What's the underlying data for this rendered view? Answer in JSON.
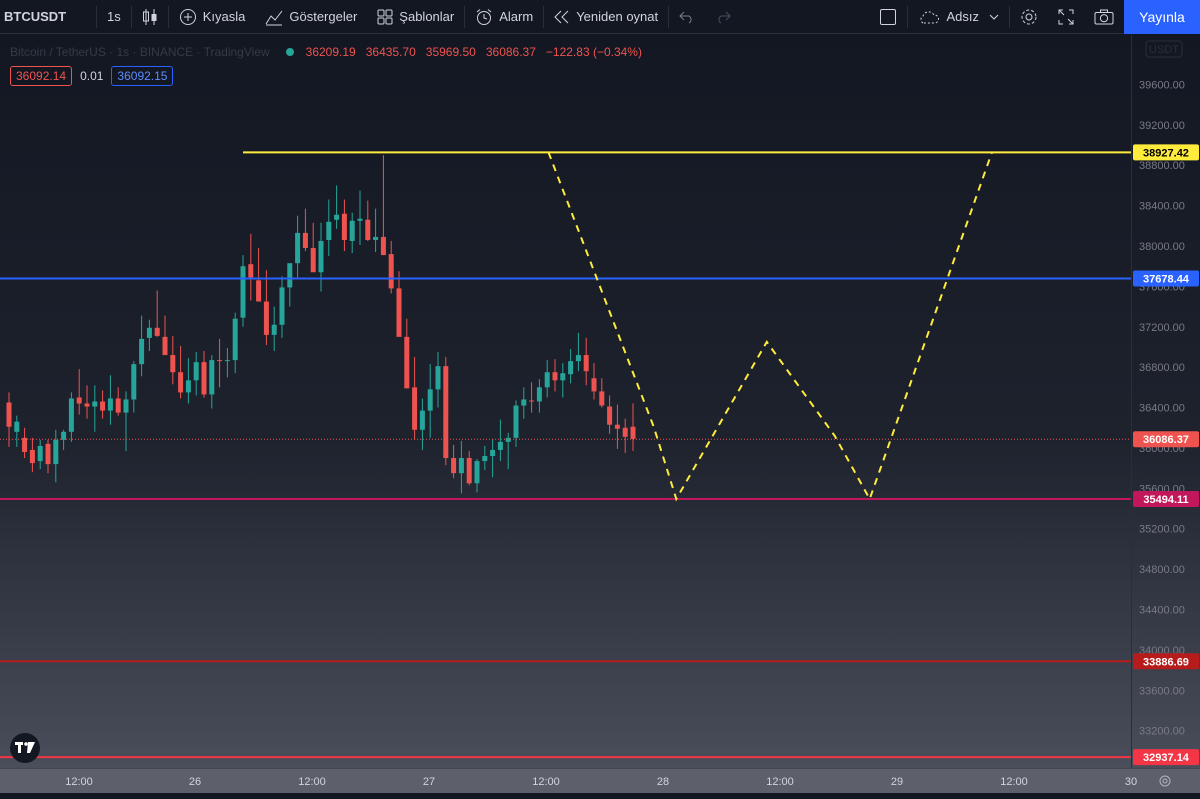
{
  "toolbar": {
    "symbol": "BTCUSDT",
    "interval": "1s",
    "compare_label": "Kıyasla",
    "indicators_label": "Göstergeler",
    "templates_label": "Şablonlar",
    "alert_label": "Alarm",
    "replay_label": "Yeniden oynat",
    "layout_name": "Adsız",
    "publish_label": "Yayınla"
  },
  "legend": {
    "title": "Bitcoin / TetherUS · 1s · BINANCE · TradingView",
    "open": "36209.19",
    "high": "36435.70",
    "low": "35969.50",
    "close": "36086.37",
    "change": "−122.83 (−0.34%)"
  },
  "quote": {
    "sell": "36092.14",
    "spread": "0.01",
    "buy": "36092.15"
  },
  "colors": {
    "up": "#26a69a",
    "down": "#ef5350",
    "accent": "#2962ff",
    "level_yellow": "#ffeb3b",
    "level_blue": "#2962ff",
    "level_magenta": "#c2185b",
    "level_red": "#b71c1c",
    "level_bright_red": "#f23645"
  },
  "chart_data": {
    "type": "candlestick",
    "y_axis_unit": "USDT",
    "y_ticks": [
      33200,
      33600,
      34000,
      34400,
      34800,
      35200,
      35600,
      36000,
      36400,
      36800,
      37200,
      37600,
      38000,
      38400,
      38800,
      39200,
      39600
    ],
    "x_ticks": [
      "12:00",
      "26",
      "12:00",
      "27",
      "12:00",
      "28",
      "12:00",
      "29",
      "12:00",
      "30"
    ],
    "ylim": [
      32830,
      40090
    ],
    "last_price": "36086.37",
    "levels": [
      {
        "price": "38927.42",
        "color": "#ffeb3b"
      },
      {
        "price": "37678.44",
        "color": "#2962ff"
      },
      {
        "price": "35494.11",
        "color": "#c2185b"
      },
      {
        "price": "33886.69",
        "color": "#b71c1c"
      },
      {
        "price": "32937.14",
        "color": "#f23645"
      }
    ],
    "candles": [
      [
        36450,
        36550,
        36010,
        36210
      ],
      [
        36160,
        36320,
        36010,
        36260
      ],
      [
        36100,
        36200,
        35900,
        35960
      ],
      [
        35980,
        36100,
        35760,
        35850
      ],
      [
        35870,
        36080,
        35790,
        36020
      ],
      [
        36040,
        36080,
        35750,
        35840
      ],
      [
        35840,
        36180,
        35660,
        36080
      ],
      [
        36080,
        36180,
        35980,
        36160
      ],
      [
        36160,
        36550,
        36060,
        36490
      ],
      [
        36500,
        36780,
        36330,
        36440
      ],
      [
        36440,
        36620,
        36290,
        36410
      ],
      [
        36410,
        36620,
        36160,
        36460
      ],
      [
        36460,
        36570,
        36290,
        36370
      ],
      [
        36370,
        36720,
        36230,
        36490
      ],
      [
        36490,
        36600,
        36320,
        36350
      ],
      [
        36350,
        36560,
        35970,
        36480
      ],
      [
        36480,
        36860,
        36350,
        36830
      ],
      [
        36830,
        37310,
        36710,
        37080
      ],
      [
        37090,
        37270,
        36960,
        37190
      ],
      [
        37190,
        37560,
        37100,
        37110
      ],
      [
        37100,
        37310,
        36950,
        36920
      ],
      [
        36920,
        37110,
        36630,
        36750
      ],
      [
        36750,
        37010,
        36490,
        36550
      ],
      [
        36550,
        36890,
        36440,
        36670
      ],
      [
        36670,
        36950,
        36520,
        36850
      ],
      [
        36850,
        36960,
        36500,
        36530
      ],
      [
        36530,
        36920,
        36390,
        36870
      ],
      [
        36870,
        37080,
        36600,
        36860
      ],
      [
        36860,
        36990,
        36700,
        36870
      ],
      [
        36870,
        37340,
        36740,
        37280
      ],
      [
        37290,
        37910,
        37200,
        37800
      ],
      [
        37820,
        38120,
        37460,
        37690
      ],
      [
        37660,
        37980,
        37490,
        37450
      ],
      [
        37450,
        37760,
        37020,
        37120
      ],
      [
        37120,
        37400,
        36960,
        37220
      ],
      [
        37220,
        37700,
        37090,
        37590
      ],
      [
        37590,
        37810,
        37400,
        37830
      ],
      [
        37830,
        38300,
        37680,
        38130
      ],
      [
        38130,
        38370,
        37950,
        37980
      ],
      [
        37980,
        38230,
        37780,
        37740
      ],
      [
        37740,
        38230,
        37550,
        38050
      ],
      [
        38060,
        38460,
        37900,
        38240
      ],
      [
        38260,
        38600,
        38170,
        38310
      ],
      [
        38320,
        38460,
        37950,
        38060
      ],
      [
        38050,
        38330,
        37930,
        38250
      ],
      [
        38250,
        38550,
        38010,
        38270
      ],
      [
        38260,
        38450,
        38050,
        38060
      ],
      [
        38060,
        38370,
        37940,
        38090
      ],
      [
        38090,
        38900,
        37910,
        37910
      ],
      [
        37920,
        38050,
        37530,
        37580
      ],
      [
        37580,
        37750,
        37280,
        37100
      ],
      [
        37100,
        37280,
        36660,
        36590
      ],
      [
        36600,
        36900,
        36080,
        36180
      ],
      [
        36180,
        36490,
        35980,
        36370
      ],
      [
        36370,
        36830,
        36100,
        36580
      ],
      [
        36580,
        36950,
        36400,
        36810
      ],
      [
        36810,
        36900,
        35830,
        35900
      ],
      [
        35900,
        36030,
        35700,
        35750
      ],
      [
        35750,
        36070,
        35550,
        35900
      ],
      [
        35900,
        35970,
        35630,
        35650
      ],
      [
        35650,
        35890,
        35560,
        35870
      ],
      [
        35870,
        36020,
        35780,
        35920
      ],
      [
        35920,
        36090,
        35710,
        35980
      ],
      [
        35980,
        36280,
        35870,
        36060
      ],
      [
        36060,
        36150,
        35790,
        36100
      ],
      [
        36100,
        36470,
        36010,
        36420
      ],
      [
        36420,
        36600,
        36290,
        36480
      ],
      [
        36470,
        36650,
        36350,
        36460
      ],
      [
        36460,
        36680,
        36350,
        36600
      ],
      [
        36600,
        36870,
        36500,
        36750
      ],
      [
        36750,
        36880,
        36560,
        36670
      ],
      [
        36670,
        36840,
        36500,
        36740
      ],
      [
        36730,
        36980,
        36640,
        36860
      ],
      [
        36860,
        37140,
        36760,
        36920
      ],
      [
        36920,
        37090,
        36620,
        36760
      ],
      [
        36690,
        36840,
        36480,
        36560
      ],
      [
        36560,
        36690,
        36400,
        36420
      ],
      [
        36410,
        36520,
        36140,
        36230
      ],
      [
        36230,
        36430,
        35990,
        36190
      ],
      [
        36200,
        36290,
        35950,
        36110
      ],
      [
        36210,
        36440,
        35970,
        36090
      ]
    ],
    "pattern_path": [
      [
        38927.42,
        48.5
      ],
      [
        36210,
        57.8
      ],
      [
        35494.11,
        59.8
      ],
      [
        37050,
        67.8
      ],
      [
        36120,
        73.8
      ],
      [
        35494.11,
        76.9
      ],
      [
        38927.42,
        87.7
      ]
    ]
  }
}
